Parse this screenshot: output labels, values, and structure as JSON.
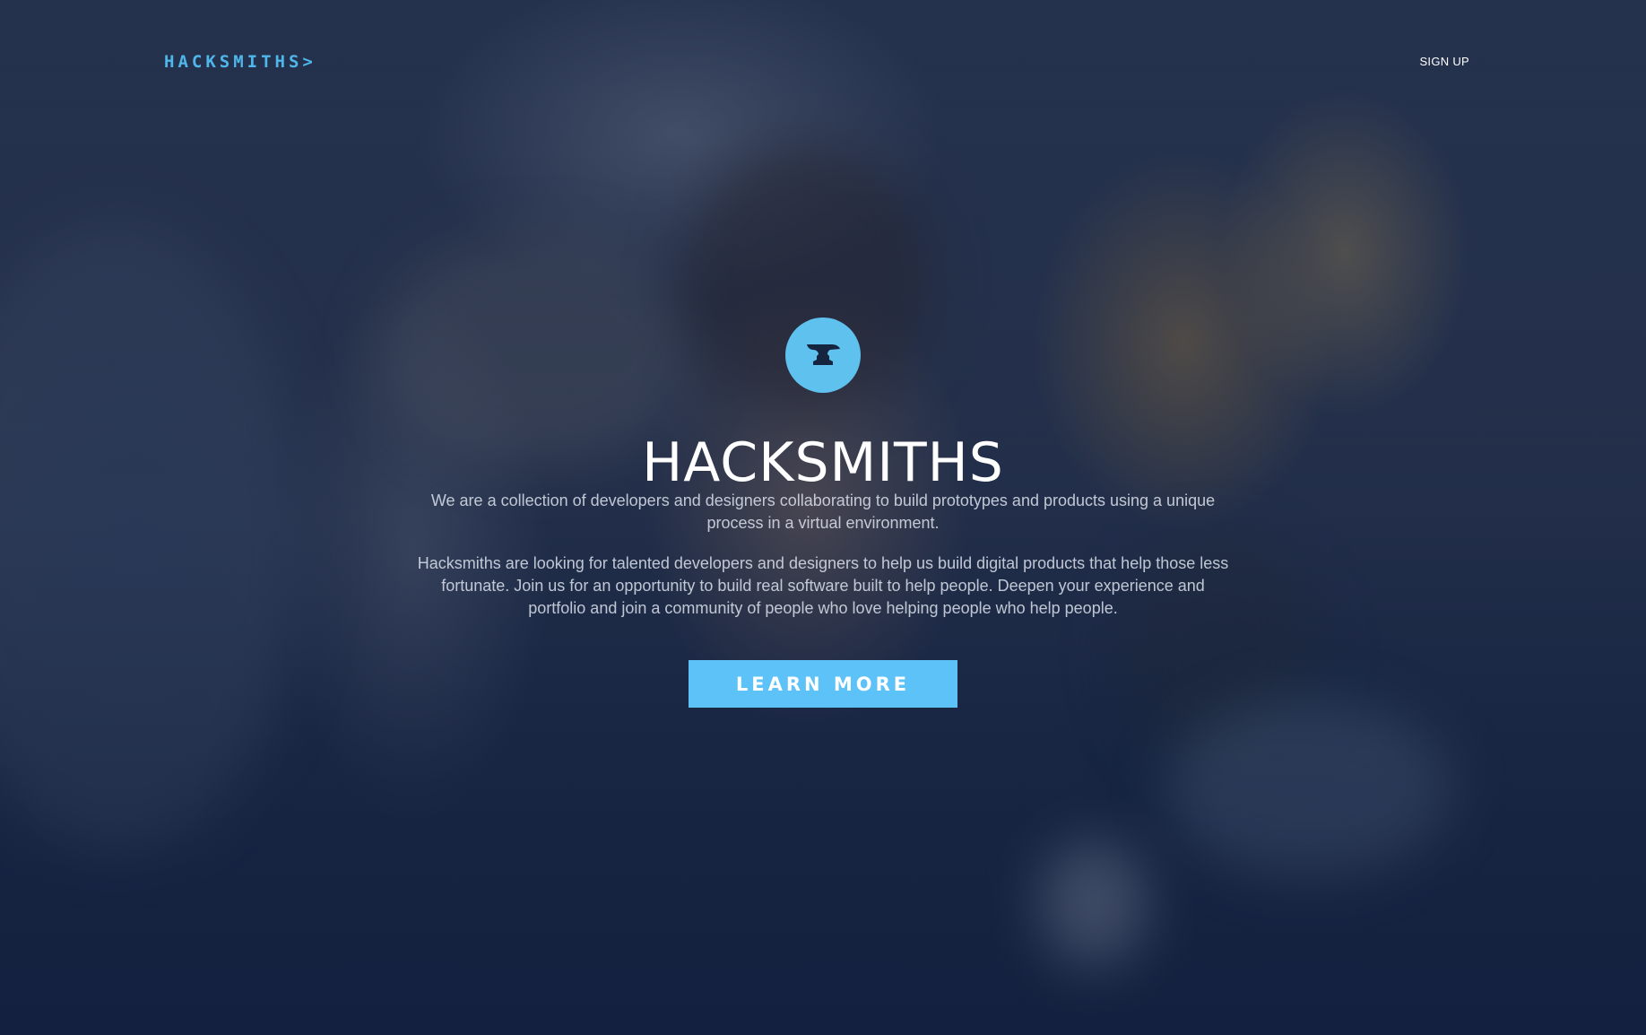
{
  "nav": {
    "logo_text": "HACKSMITHS",
    "logo_open_bracket": "(",
    "logo_close_bracket": ">",
    "signup_label": "SIGN UP"
  },
  "hero": {
    "badge_icon": "anvil-icon",
    "title": "HACKSMITHS",
    "intro": "We are a collection of developers and designers collaborating to build prototypes and products using a unique process in a virtual environment.",
    "body": "Hacksmiths are looking for talented developers and designers to help us build digital products that help those less fortunate. Join us for an opportunity to build real software built to help people. Deepen your experience and portfolio and join a community of people who love helping people who help people.",
    "button_label": "LEARN MORE"
  },
  "colors": {
    "accent": "#5cc2f7",
    "logo": "#4fb6ea",
    "background": "#1f2c45",
    "text": "#ffffff"
  }
}
